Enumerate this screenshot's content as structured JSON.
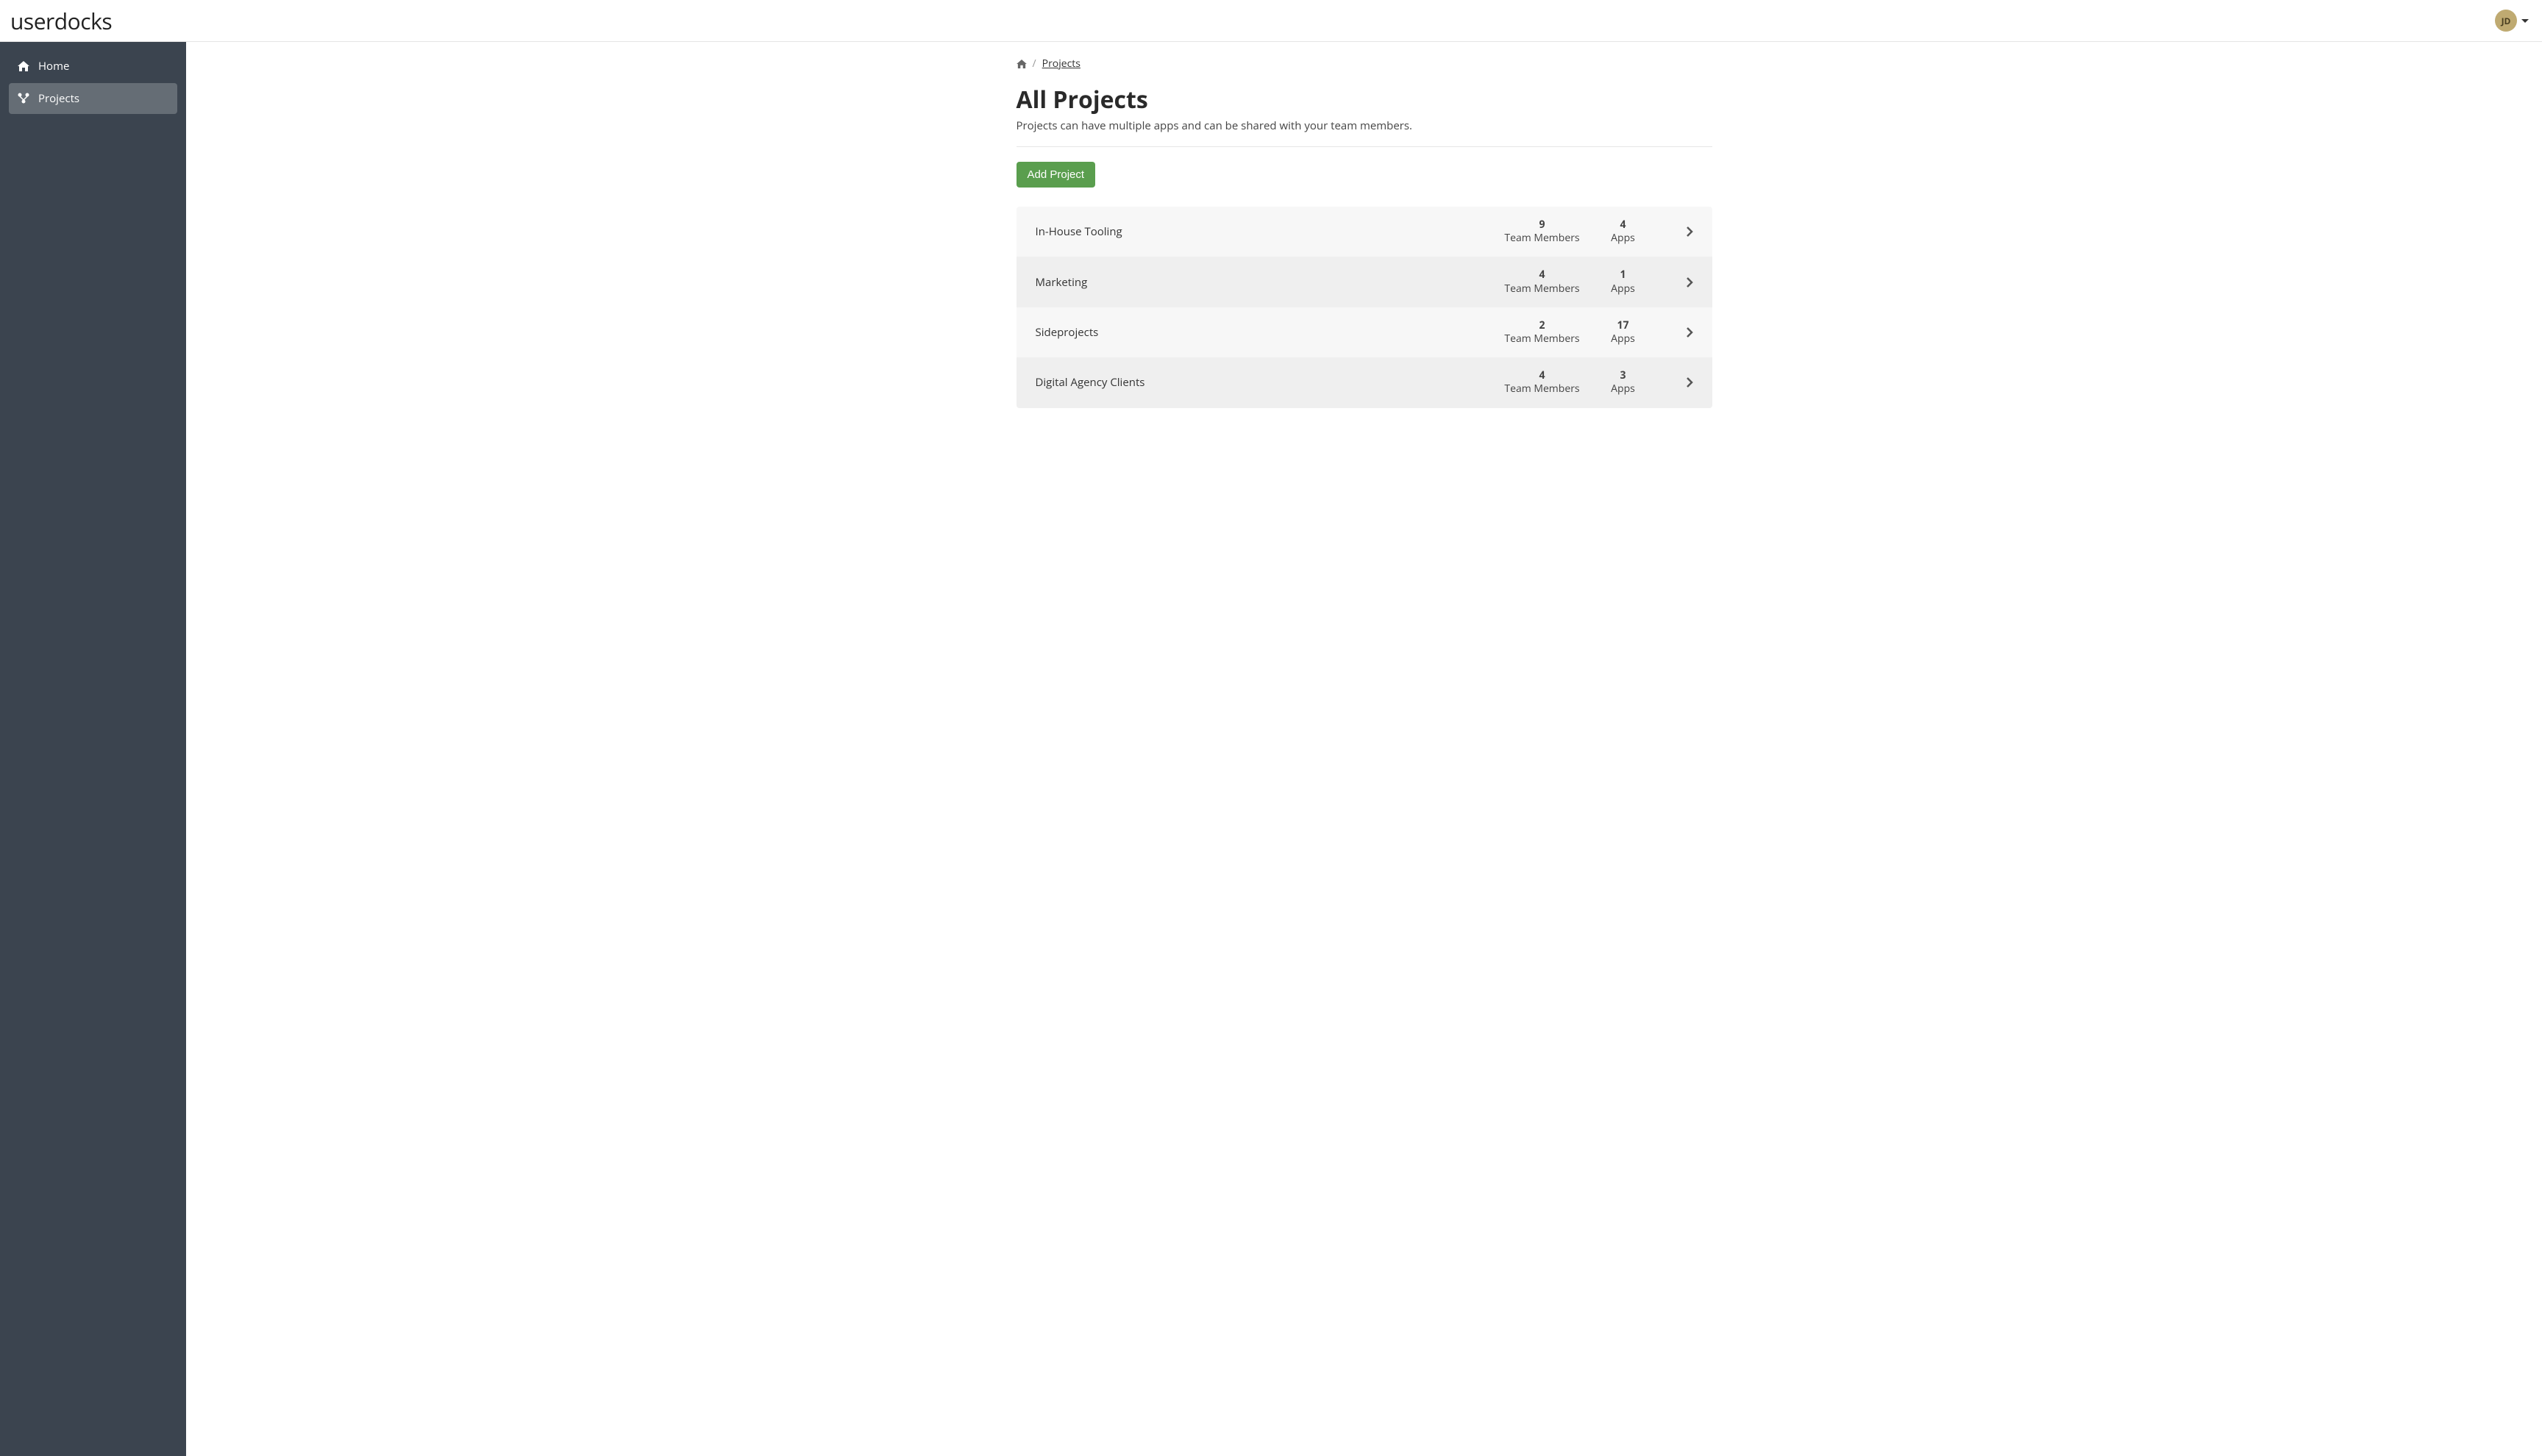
{
  "brand": "userdocks",
  "user": {
    "initials": "JD"
  },
  "sidebar": {
    "items": [
      {
        "label": "Home"
      },
      {
        "label": "Projects"
      }
    ]
  },
  "breadcrumb": {
    "current": "Projects"
  },
  "page": {
    "title": "All Projects",
    "subtitle": "Projects can have multiple apps and can be shared with your team members.",
    "addButton": "Add Project"
  },
  "labels": {
    "teamMembers": "Team Members",
    "apps": "Apps"
  },
  "projects": [
    {
      "name": "In-House Tooling",
      "members": "9",
      "apps": "4"
    },
    {
      "name": "Marketing",
      "members": "4",
      "apps": "1"
    },
    {
      "name": "Sideprojects",
      "members": "2",
      "apps": "17"
    },
    {
      "name": "Digital Agency Clients",
      "members": "4",
      "apps": "3"
    }
  ]
}
